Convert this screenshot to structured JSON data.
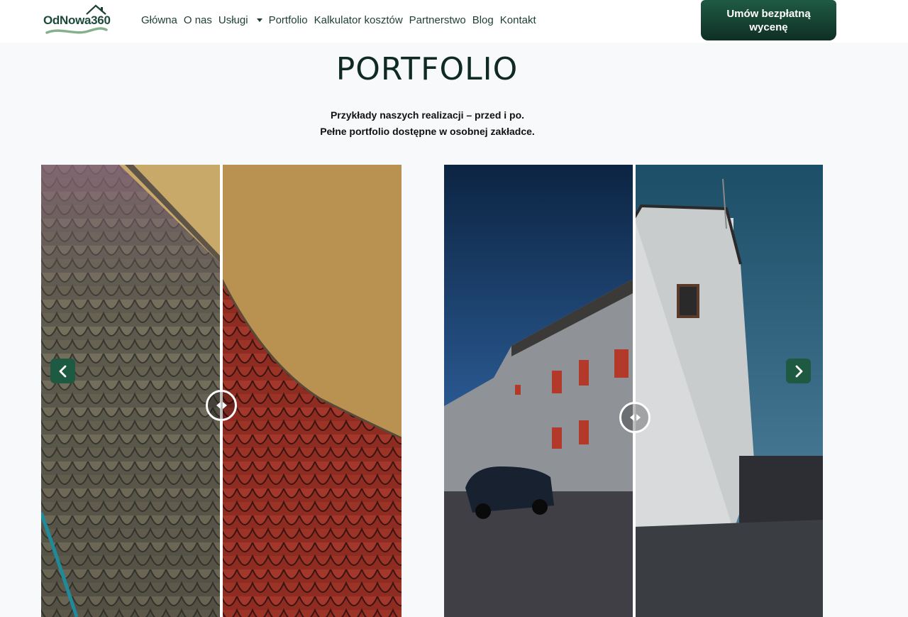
{
  "header": {
    "logo_text": "OdNowa360",
    "nav": [
      {
        "label": "Główna"
      },
      {
        "label": "O nas"
      },
      {
        "label": "Usługi",
        "has_dropdown": true
      },
      {
        "label": "Portfolio"
      },
      {
        "label": "Kalkulator kosztów"
      },
      {
        "label": "Partnerstwo"
      },
      {
        "label": "Blog"
      },
      {
        "label": "Kontakt"
      }
    ],
    "cta_label": "Umów bezpłatną wycenę"
  },
  "main": {
    "title": "PORTFOLIO",
    "subtitle_line1": "Przykłady naszych realizacji – przed i po.",
    "subtitle_line2": "Pełne portfolio dostępne w osobnej zakładce."
  },
  "sliders": [
    {
      "name": "roof-shingles",
      "split": 0.5
    },
    {
      "name": "building-facade",
      "split": 0.5
    }
  ],
  "colors": {
    "brand_dark": "#0f2f24",
    "brand": "#1e5a41",
    "background": "#f7f9fb"
  }
}
